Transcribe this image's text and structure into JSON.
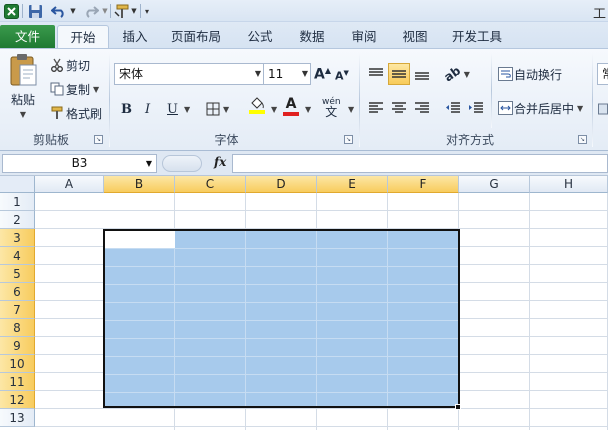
{
  "app": {
    "title_fragment": "工"
  },
  "qat": {
    "icons": [
      "excel-logo-icon",
      "save-icon",
      "undo-icon",
      "redo-icon",
      "format-painter-icon",
      "customize-icon"
    ]
  },
  "tabs": [
    {
      "id": "file",
      "label": "文件"
    },
    {
      "id": "home",
      "label": "开始",
      "active": true
    },
    {
      "id": "insert",
      "label": "插入"
    },
    {
      "id": "page-layout",
      "label": "页面布局"
    },
    {
      "id": "formulas",
      "label": "公式"
    },
    {
      "id": "data",
      "label": "数据"
    },
    {
      "id": "review",
      "label": "审阅"
    },
    {
      "id": "view",
      "label": "视图"
    },
    {
      "id": "developer",
      "label": "开发工具"
    }
  ],
  "ribbon": {
    "clipboard": {
      "paste_label": "粘贴",
      "cut_label": "剪切",
      "copy_label": "复制",
      "format_painter_label": "格式刷",
      "group_label": "剪贴板"
    },
    "font": {
      "font_name": "宋体",
      "font_size": "11",
      "bold": "B",
      "italic": "I",
      "underline": "U",
      "phonetic": "wén",
      "group_label": "字体"
    },
    "alignment": {
      "wrap_text_label": "自动换行",
      "merge_center_label": "合并后居中",
      "group_label": "对齐方式"
    },
    "number": {
      "format_fragment": "常"
    }
  },
  "formula_bar": {
    "name_box": "B3",
    "fx": "fx",
    "value": ""
  },
  "sheet": {
    "columns": [
      "A",
      "B",
      "C",
      "D",
      "E",
      "F",
      "G",
      "H"
    ],
    "rows": [
      "1",
      "2",
      "3",
      "4",
      "5",
      "6",
      "7",
      "8",
      "9",
      "10",
      "11",
      "12",
      "13"
    ],
    "selected_range": "B3:F12",
    "active_cell": "B3",
    "selection_color": "#a7caec",
    "header_highlight_color": "#f8cc5e"
  },
  "colors": {
    "file_tab": "#1f7a33",
    "fill_color_bar": "#ffff00",
    "font_color_bar": "#e02020"
  }
}
